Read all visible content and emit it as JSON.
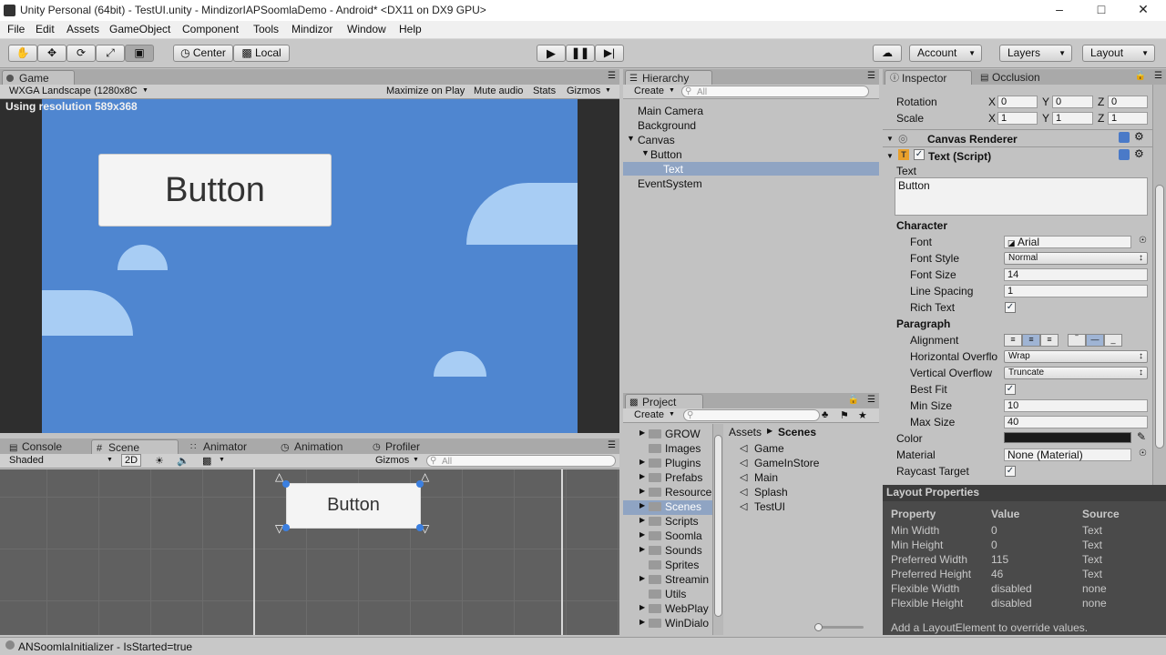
{
  "window": {
    "title": "Unity Personal (64bit) - TestUI.unity - MindizorIAPSoomlaDemo - Android* <DX11 on DX9 GPU>"
  },
  "menu": [
    "File",
    "Edit",
    "Assets",
    "GameObject",
    "Component",
    "Tools",
    "Mindizor",
    "Window",
    "Help"
  ],
  "toolbar": {
    "center": "Center",
    "local": "Local",
    "account": "Account",
    "layers": "Layers",
    "layout": "Layout"
  },
  "game": {
    "tab": "Game",
    "resolution_select": "WXGA Landscape (1280x8C",
    "maximize": "Maximize on Play",
    "mute": "Mute audio",
    "stats": "Stats",
    "gizmos": "Gizmos",
    "using_resolution": "Using resolution 589x368",
    "button_text": "Button"
  },
  "bottom_tabs": {
    "console": "Console",
    "scene": "Scene",
    "animator": "Animator",
    "animation": "Animation",
    "profiler": "Profiler"
  },
  "scene": {
    "shaded": "Shaded",
    "mode2d": "2D",
    "gizmos": "Gizmos",
    "search_placeholder": "All",
    "button_text": "Button"
  },
  "hierarchy": {
    "tab": "Hierarchy",
    "create": "Create",
    "search_placeholder": "All",
    "items": [
      "Main Camera",
      "Background",
      "Canvas",
      "Button",
      "Text",
      "EventSystem"
    ]
  },
  "project": {
    "tab": "Project",
    "create": "Create",
    "folders": [
      "GROW",
      "Images",
      "Plugins",
      "Prefabs",
      "Resources",
      "Scenes",
      "Scripts",
      "Soomla",
      "Sounds",
      "Sprites",
      "StreamingAssets",
      "Utils",
      "WebPlayerTemplates",
      "WinDialog"
    ],
    "folders_visible": [
      "GROW",
      "Images",
      "Plugins",
      "Prefabs",
      "Resource",
      "Scenes",
      "Scripts",
      "Soomla",
      "Sounds",
      "Sprites",
      "Streamin",
      "Utils",
      "WebPlay",
      "WinDialo"
    ],
    "breadcrumb_root": "Assets",
    "breadcrumb_current": "Scenes",
    "scenes": [
      "Game",
      "GameInStore",
      "Main",
      "Splash",
      "TestUI"
    ]
  },
  "inspector": {
    "tab": "Inspector",
    "tab2": "Occlusion",
    "rotation": {
      "label": "Rotation",
      "x": "0",
      "y": "0",
      "z": "0"
    },
    "scale": {
      "label": "Scale",
      "x": "1",
      "y": "1",
      "z": "1"
    },
    "canvas_renderer": "Canvas Renderer",
    "text_script": "Text (Script)",
    "text_label": "Text",
    "text_value": "Button",
    "character": "Character",
    "font": {
      "label": "Font",
      "value": "Arial"
    },
    "font_style": {
      "label": "Font Style",
      "value": "Normal"
    },
    "font_size": {
      "label": "Font Size",
      "value": "14"
    },
    "line_spacing": {
      "label": "Line Spacing",
      "value": "1"
    },
    "rich_text": {
      "label": "Rich Text",
      "checked": true
    },
    "paragraph": "Paragraph",
    "alignment": {
      "label": "Alignment"
    },
    "h_overflow": {
      "label": "Horizontal Overflo",
      "value": "Wrap"
    },
    "v_overflow": {
      "label": "Vertical Overflow",
      "value": "Truncate"
    },
    "best_fit": {
      "label": "Best Fit",
      "checked": true
    },
    "min_size": {
      "label": "Min Size",
      "value": "10"
    },
    "max_size": {
      "label": "Max Size",
      "value": "40"
    },
    "color": {
      "label": "Color",
      "value": "#1a1a1a"
    },
    "material": {
      "label": "Material",
      "value": "None (Material)"
    },
    "raycast": {
      "label": "Raycast Target",
      "checked": true
    }
  },
  "layout_props": {
    "title": "Layout Properties",
    "headers": [
      "Property",
      "Value",
      "Source"
    ],
    "rows": [
      [
        "Min Width",
        "0",
        "Text"
      ],
      [
        "Min Height",
        "0",
        "Text"
      ],
      [
        "Preferred Width",
        "115",
        "Text"
      ],
      [
        "Preferred Height",
        "46",
        "Text"
      ],
      [
        "Flexible Width",
        "disabled",
        "none"
      ],
      [
        "Flexible Height",
        "disabled",
        "none"
      ]
    ],
    "footer": "Add a LayoutElement to override values."
  },
  "status": "ANSoomlaInitializer - IsStarted=true",
  "colors": {
    "sky": "#4f86d0",
    "cloud": "#a8cdf4",
    "selection": "#8fa4c3"
  }
}
